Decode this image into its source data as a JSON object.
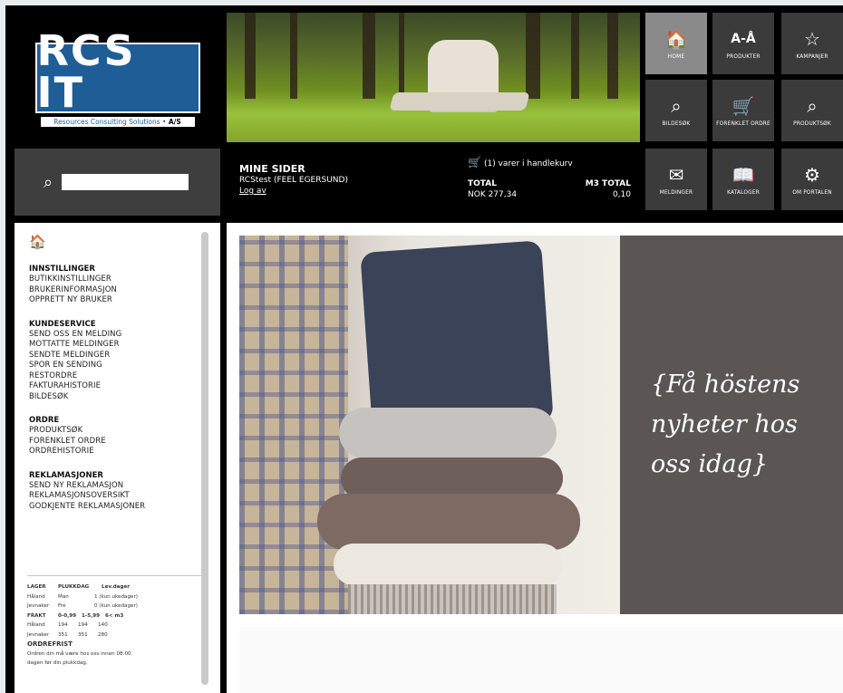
{
  "logo": {
    "main": "RCS IT",
    "sub": "Resources Consulting Solutions",
    "sub_suffix": "A/S"
  },
  "tiles": [
    {
      "key": "home",
      "label": "HOME",
      "icon": "home-icon",
      "glyph": "🏠"
    },
    {
      "key": "produkter",
      "label": "PRODUKTER",
      "icon": "az-icon",
      "glyph": "A-Å"
    },
    {
      "key": "kampanjer",
      "label": "KAMPANJER",
      "icon": "star-icon",
      "glyph": "☆"
    },
    {
      "key": "bildesok",
      "label": "BILDESØK",
      "icon": "image-search-icon",
      "glyph": "⌕"
    },
    {
      "key": "forenklet",
      "label": "FORENKLET ORDRE",
      "icon": "cart-icon",
      "glyph": "🛒"
    },
    {
      "key": "produktsok",
      "label": "PRODUKTSØK",
      "icon": "search-icon",
      "glyph": "⌕"
    },
    {
      "key": "meldinger",
      "label": "MELDINGER",
      "icon": "envelope-icon",
      "glyph": "✉"
    },
    {
      "key": "kataloger",
      "label": "KATALOGER",
      "icon": "book-icon",
      "glyph": "📖"
    },
    {
      "key": "om",
      "label": "OM PORTALEN",
      "icon": "gear-icon",
      "glyph": "⚙"
    }
  ],
  "account": {
    "title": "MINE SIDER",
    "user": "RCStest (FEEL EGERSUND)",
    "logout": "Log av",
    "cart": "(1) varer i handlekurv",
    "total_label": "TOTAL",
    "total_value": "NOK 277,34",
    "m3_label": "M3 TOTAL",
    "m3_value": "0,10"
  },
  "sidebar": {
    "groups": [
      {
        "title": "INNSTILLINGER",
        "items": [
          "BUTIKKINSTILLINGER",
          "BRUKERINFORMASJON",
          "OPPRETT NY BRUKER"
        ]
      },
      {
        "title": "KUNDESERVICE",
        "items": [
          "SEND OSS EN MELDING",
          "MOTTATTE MELDINGER",
          "SENDTE MELDINGER",
          "SPOR EN SENDING",
          "RESTORDRE",
          "FAKTURAHISTORIE",
          "BILDESØK"
        ]
      },
      {
        "title": "ORDRE",
        "items": [
          "PRODUKTSØK",
          "FORENKLET ORDRE",
          "ORDREHISTORIE"
        ]
      },
      {
        "title": "REKLAMASJONER",
        "items": [
          "SEND NY REKLAMASJON",
          "REKLAMASJONSOVERSIKT",
          "GODKJENTE REKLAMASJONER"
        ]
      }
    ],
    "info": {
      "head1": [
        "LAGER",
        "PLUKKDAG",
        "Lev.dager"
      ],
      "rows1": [
        [
          "Håland",
          "Man",
          "1 (kun ukedager)"
        ],
        [
          "Jevnaker",
          "Fre",
          "0 (kun ukedager)"
        ]
      ],
      "head2": [
        "FRAKT",
        "0-0,99",
        "1-5,99",
        "6< m3"
      ],
      "rows2": [
        [
          "Håland",
          "194",
          "194",
          "140"
        ],
        [
          "Jevnaker",
          "351",
          "351",
          "280"
        ]
      ],
      "head3": "ORDREFRIST",
      "note1": "Ordren din må være hos oss innen 08:00",
      "note2": "dagen før din plukkdag."
    }
  },
  "banner": {
    "quote": "{Få höstens nyheter hos oss idag}"
  }
}
